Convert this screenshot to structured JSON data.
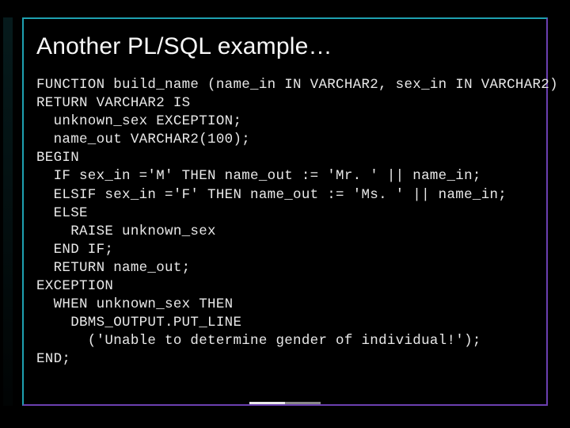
{
  "slide": {
    "title": "Another PL/SQL example…",
    "code": {
      "l1": "FUNCTION build_name (name_in IN VARCHAR2, sex_in IN VARCHAR2)",
      "l2": "RETURN VARCHAR2 IS",
      "l3": "  unknown_sex EXCEPTION;",
      "l4": "  name_out VARCHAR2(100);",
      "l5": "BEGIN",
      "l6": "  IF sex_in ='M' THEN name_out := 'Mr. ' || name_in;",
      "l7": "  ELSIF sex_in ='F' THEN name_out := 'Ms. ' || name_in;",
      "l8": "  ELSE",
      "l9": "    RAISE unknown_sex",
      "l10": "  END IF;",
      "l11": "  RETURN name_out;",
      "l12": "EXCEPTION",
      "l13": "  WHEN unknown_sex THEN",
      "l14": "    DBMS_OUTPUT.PUT_LINE",
      "l15": "      ('Unable to determine gender of individual!');",
      "l16": "END;"
    }
  }
}
